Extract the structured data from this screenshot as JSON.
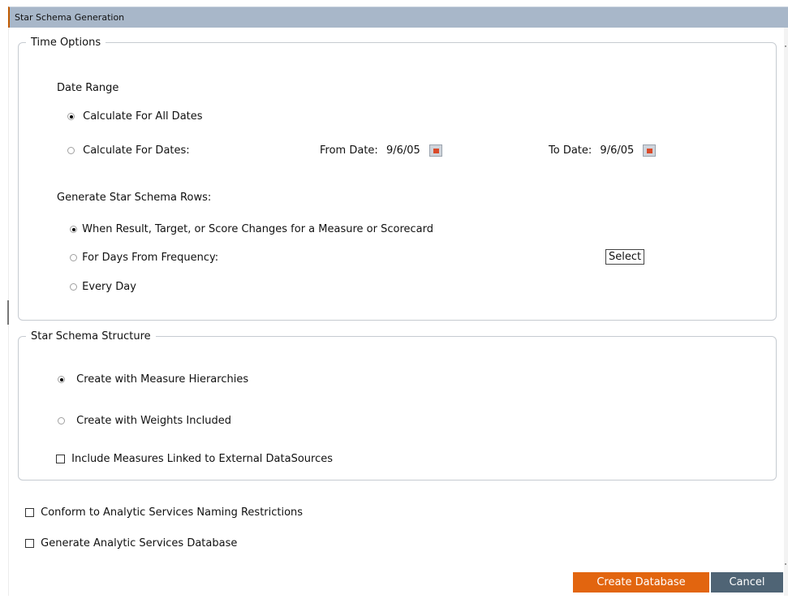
{
  "window": {
    "title": "Star Schema Generation"
  },
  "time_options": {
    "legend": "Time Options",
    "date_range_label": "Date Range",
    "radio_all_dates": {
      "label": "Calculate For All Dates",
      "checked": true
    },
    "radio_for_dates": {
      "label": "Calculate For Dates:",
      "checked": false
    },
    "from_date_label": "From Date:",
    "from_date_value": "9/6/05",
    "to_date_label": "To Date:",
    "to_date_value": "9/6/05",
    "generate_rows_label": "Generate Star Schema Rows:",
    "radio_on_change": {
      "label": "When Result, Target, or Score Changes for a Measure or Scorecard",
      "checked": true
    },
    "radio_frequency": {
      "label": "For Days From Frequency:",
      "checked": false
    },
    "select_button": "Select",
    "radio_every_day": {
      "label": "Every Day",
      "checked": false
    }
  },
  "structure": {
    "legend": "Star Schema Structure",
    "radio_hierarchies": {
      "label": "Create with Measure Hierarchies",
      "checked": true
    },
    "radio_weights": {
      "label": "Create with Weights Included",
      "checked": false
    },
    "include_external": {
      "label": "Include Measures Linked to External DataSources",
      "checked": false
    }
  },
  "options": {
    "conform_naming": {
      "label": "Conform to Analytic Services Naming Restrictions",
      "checked": false
    },
    "generate_db": {
      "label": "Generate Analytic Services Database",
      "checked": false
    }
  },
  "buttons": {
    "create": "Create Database",
    "cancel": "Cancel"
  },
  "colors": {
    "create_button": "#e2650f",
    "cancel_button": "#4f6475",
    "title_bar": "#a8b7c9"
  }
}
